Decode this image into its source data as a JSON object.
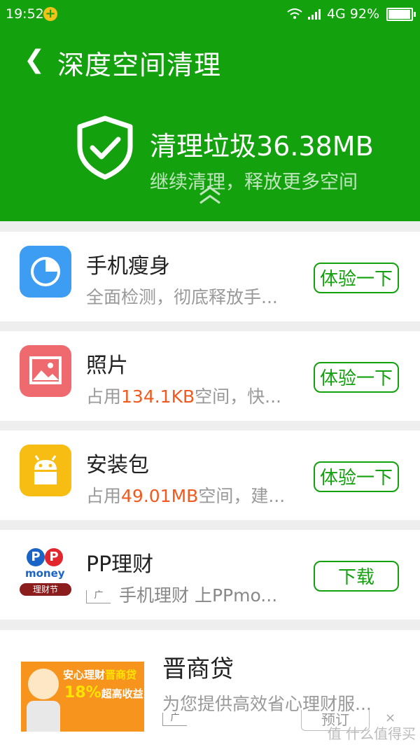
{
  "status_bar": {
    "time": "19:52",
    "network": "4G",
    "battery": "92%",
    "battery_level": 0.92
  },
  "header": {
    "title": "深度空间清理",
    "summary": "清理垃圾36.38MB",
    "sub": "继续清理，释放更多空间",
    "bg_color": "#13a10e"
  },
  "cards": [
    {
      "name": "手机瘦身",
      "desc_pre": "全面检测，彻底释放手...",
      "desc_hl": "",
      "desc_post": "",
      "button": "体验一下",
      "icon": "pie-chart-icon",
      "icon_color": "#3d9df3"
    },
    {
      "name": "照片",
      "desc_pre": "占用",
      "desc_hl": "134.1KB",
      "desc_post": "空间，快...",
      "button": "体验一下",
      "icon": "image-icon",
      "icon_color": "#ee6a6e"
    },
    {
      "name": "安装包",
      "desc_pre": "占用",
      "desc_hl": "49.01MB",
      "desc_post": "空间，建...",
      "button": "体验一下",
      "icon": "android-icon",
      "icon_color": "#f7bd12"
    }
  ],
  "ad1": {
    "name": "PP理财",
    "ad_tag": "广",
    "desc": "手机理财 上PPmo...",
    "button": "下载",
    "logo_letters": "PP",
    "logo_word": "money",
    "logo_sub": "理财节"
  },
  "ad2": {
    "name": "晋商贷",
    "ad_tag": "广",
    "desc": "为您提供高效省心理财服...",
    "button": "预订",
    "close": "×",
    "image_text_1": "安心理财",
    "image_text_2": "晋商贷",
    "image_text_3": "18%",
    "image_text_4": "超高收益!"
  },
  "watermark": "值 什么值得买"
}
